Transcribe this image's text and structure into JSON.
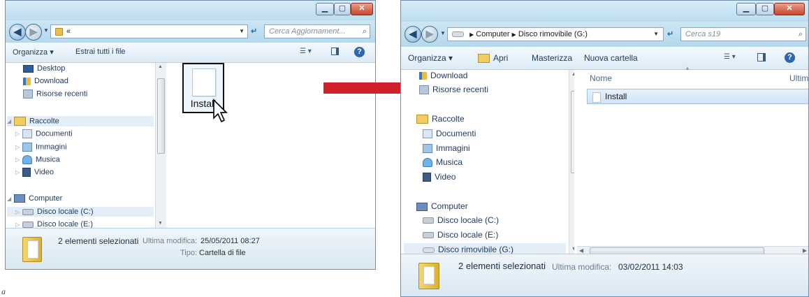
{
  "captions": {
    "top": "",
    "bottom": "a"
  },
  "left_window": {
    "address": "«",
    "search_placeholder": "Cerca Aggiornament...",
    "toolbar": {
      "organize": "Organizza ▾",
      "extract_all": "Estrai tutti i file"
    },
    "nav": {
      "desktop": "Desktop",
      "download": "Download",
      "recent": "Risorse recenti",
      "libraries": "Raccolte",
      "documents": "Documenti",
      "pictures": "Immagini",
      "music": "Musica",
      "video": "Video",
      "computer": "Computer",
      "disk_c": "Disco locale (C:)",
      "disk_e": "Disco locale (E:)"
    },
    "file": {
      "name": "Install"
    },
    "details": {
      "selected": "2 elementi selezionati",
      "modified_label": "Ultima modifica:",
      "modified_value": "25/05/2011 08:27",
      "type_label": "Tipo:",
      "type_value": "Cartella di file"
    }
  },
  "right_window": {
    "breadcrumb": [
      "Computer",
      "Disco rimovibile (G:)"
    ],
    "search_placeholder": "Cerca s19",
    "toolbar": {
      "organize": "Organizza ▾",
      "open": "Apri",
      "burn": "Masterizza",
      "new_folder": "Nuova cartella"
    },
    "nav": {
      "download": "Download",
      "recent": "Risorse recenti",
      "libraries": "Raccolte",
      "documents": "Documenti",
      "pictures": "Immagini",
      "music": "Musica",
      "video": "Video",
      "computer": "Computer",
      "disk_c": "Disco locale (C:)",
      "disk_e": "Disco locale (E:)",
      "disk_g": "Disco rimovibile (G:)"
    },
    "columns": {
      "name": "Nome",
      "modified": "Ultim"
    },
    "file": {
      "name": "Install"
    },
    "details": {
      "selected": "2 elementi selezionati",
      "modified_label": "Ultima modifica:",
      "modified_value": "03/02/2011 14:03"
    }
  },
  "colors": {
    "arrow": "#d0212a",
    "window_frame": "#bcdcee"
  }
}
